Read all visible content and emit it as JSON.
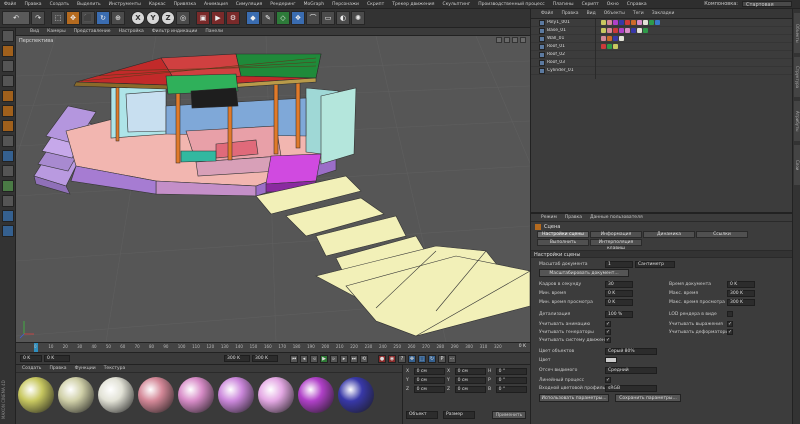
{
  "menubar": {
    "items": [
      "Файл",
      "Правка",
      "Создать",
      "Выделить",
      "Инструменты",
      "Каркас",
      "Привязка",
      "Анимация",
      "Симуляция",
      "Рендеринг",
      "MoGraph",
      "Персонажи",
      "Скрипт",
      "Трекер движения",
      "Скульптинг",
      "Производственный процесс",
      "Плагины",
      "Скрипт",
      "Окно",
      "Справка"
    ],
    "layout_label": "Компоновка:",
    "layout_value": "Стартовая"
  },
  "toolbar": {
    "icons": [
      "undo-icon",
      "redo-icon",
      "live-selection-icon",
      "move-icon",
      "scale-icon",
      "rotate-icon",
      "axis-x-icon",
      "axis-y-icon",
      "axis-z-icon",
      "world-coords-icon",
      "render-view-icon",
      "render-icon",
      "render-settings-icon",
      "cube-icon",
      "pen-icon",
      "subdivision-icon",
      "array-icon",
      "deformer-icon",
      "floor-icon",
      "camera-icon",
      "light-icon"
    ],
    "axis_labels": [
      "X",
      "Y",
      "Z"
    ]
  },
  "viewport": {
    "menu": [
      "Вид",
      "Камеры",
      "Представление",
      "Настройка",
      "Фильтр индикации",
      "Панели"
    ],
    "label": "Перспектива"
  },
  "timeline": {
    "ticks": [
      "0",
      "10",
      "20",
      "30",
      "40",
      "50",
      "60",
      "70",
      "80",
      "90",
      "100",
      "110",
      "120",
      "130",
      "140",
      "150",
      "160",
      "170",
      "180",
      "190",
      "200",
      "210",
      "220",
      "230",
      "240",
      "250",
      "260",
      "270",
      "280",
      "290",
      "300",
      "310",
      "320"
    ],
    "end_label": "0 K"
  },
  "transport": {
    "current_frame": "0 K",
    "start_field": "0 K",
    "end_field": "300 K",
    "end_field2": "300 K"
  },
  "material_manager": {
    "menu": [
      "Создать",
      "Правка",
      "Функции",
      "Текстура"
    ],
    "materials": [
      {
        "color": "#c8c860"
      },
      {
        "color": "#d0d0a8"
      },
      {
        "color": "#e2e2d6"
      },
      {
        "color": "#d48898"
      },
      {
        "color": "#d88cc8"
      },
      {
        "color": "#cc88dc"
      },
      {
        "color": "#e4a8e4"
      },
      {
        "color": "#b040c8"
      },
      {
        "color": "#3838a8"
      }
    ]
  },
  "coordinates": {
    "rows": [
      {
        "a": "X",
        "av": "0 см",
        "b": "X",
        "bv": "0 см",
        "c": "H",
        "cv": "0 °"
      },
      {
        "a": "Y",
        "av": "0 см",
        "b": "Y",
        "bv": "0 см",
        "c": "P",
        "cv": "0 °"
      },
      {
        "a": "Z",
        "av": "0 см",
        "b": "Z",
        "bv": "0 см",
        "c": "B",
        "cv": "0 °"
      }
    ],
    "dropdown1": "Объект",
    "dropdown2": "Размер",
    "apply": "Применить"
  },
  "object_manager": {
    "menu": [
      "Файл",
      "Правка",
      "Вид",
      "Объекты",
      "Теги",
      "Закладки"
    ],
    "objects": [
      {
        "name": "Poly1_001"
      },
      {
        "name": "Base_01"
      },
      {
        "name": "Wall_01"
      },
      {
        "name": "Roof_01"
      },
      {
        "name": "Roof_02"
      },
      {
        "name": "Roof_03"
      },
      {
        "name": "Cylinder_01"
      }
    ]
  },
  "attribute_manager": {
    "menu": [
      "Режим",
      "Правка",
      "Данные пользователя"
    ],
    "title": "Сцена",
    "tabs": [
      "Настройки сцены",
      "Информация",
      "Динамика",
      "Ссылки",
      "Выполнить",
      "Интерполяция клавиш"
    ],
    "section": "Настройки сцены",
    "doc_scale_label": "Масштаб документа",
    "doc_scale_value": "1",
    "doc_scale_unit": "Сантиметр",
    "scale_btn": "Масштабировать документ...",
    "fps_label": "Кадров в секунду",
    "fps_value": "30",
    "doc_time_label": "Время документа",
    "doc_time_value": "0 K",
    "min_time_label": "Мин. время",
    "min_time_value": "0 K",
    "max_time_label": "Макс. время",
    "max_time_value": "300 K",
    "min_preview_label": "Мин. время просмотра",
    "min_preview_value": "0 K",
    "max_preview_label": "Макс. время просмотра",
    "max_preview_value": "300 K",
    "lod_label": "Детализация",
    "lod_value": "100 %",
    "render_lod_label": "LOD рендера в виде",
    "use_anim_label": "Учитывать анимацию",
    "use_expr_label": "Учитывать выражения",
    "use_gen_label": "Учитывать генераторы",
    "use_deform_label": "Учитывать деформаторы",
    "use_motion_label": "Учитывать систему движения",
    "obj_color_label": "Цвет объектов",
    "obj_color_value": "Серый 80%",
    "color_label": "Цвет",
    "clip_label": "Отсеч видимого",
    "clip_value": "Средний",
    "linear_label": "Линейный процесс",
    "input_profile_label": "Входной цветовой профиль",
    "input_profile_value": "sRGB",
    "btn1": "Использовать параметры...",
    "btn2": "Сохранить параметры..."
  },
  "right_tabs": [
    "Объекты",
    "Структура",
    "Атрибуты",
    "Слои"
  ],
  "brand_text": "MAXON CINEMA 4D"
}
